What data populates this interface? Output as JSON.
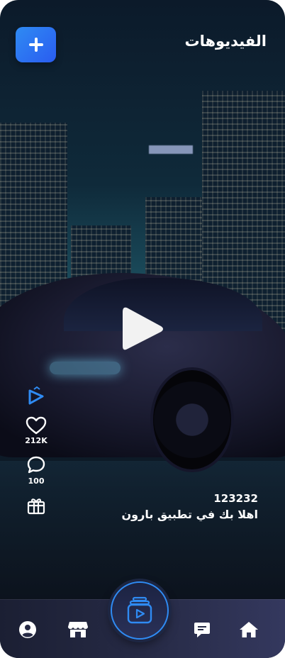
{
  "header": {
    "title": "الفيديوهات"
  },
  "actions": {
    "likes_count": "212K",
    "comments_count": "100"
  },
  "caption": {
    "id": "123232",
    "text": "اهلا بك في تطبيق بارون"
  },
  "icons": {
    "add": "plus-icon",
    "play": "play-icon",
    "brand": "brand-logo-icon",
    "like": "heart-icon",
    "comment": "comment-icon",
    "gift": "gift-icon",
    "profile": "user-icon",
    "store": "store-icon",
    "reels": "video-icon",
    "messages": "chat-icon",
    "home": "home-icon"
  },
  "colors": {
    "accent": "#2f8bf3",
    "accent_dark": "#2a5cf0",
    "nav_bg": "#262a45"
  }
}
